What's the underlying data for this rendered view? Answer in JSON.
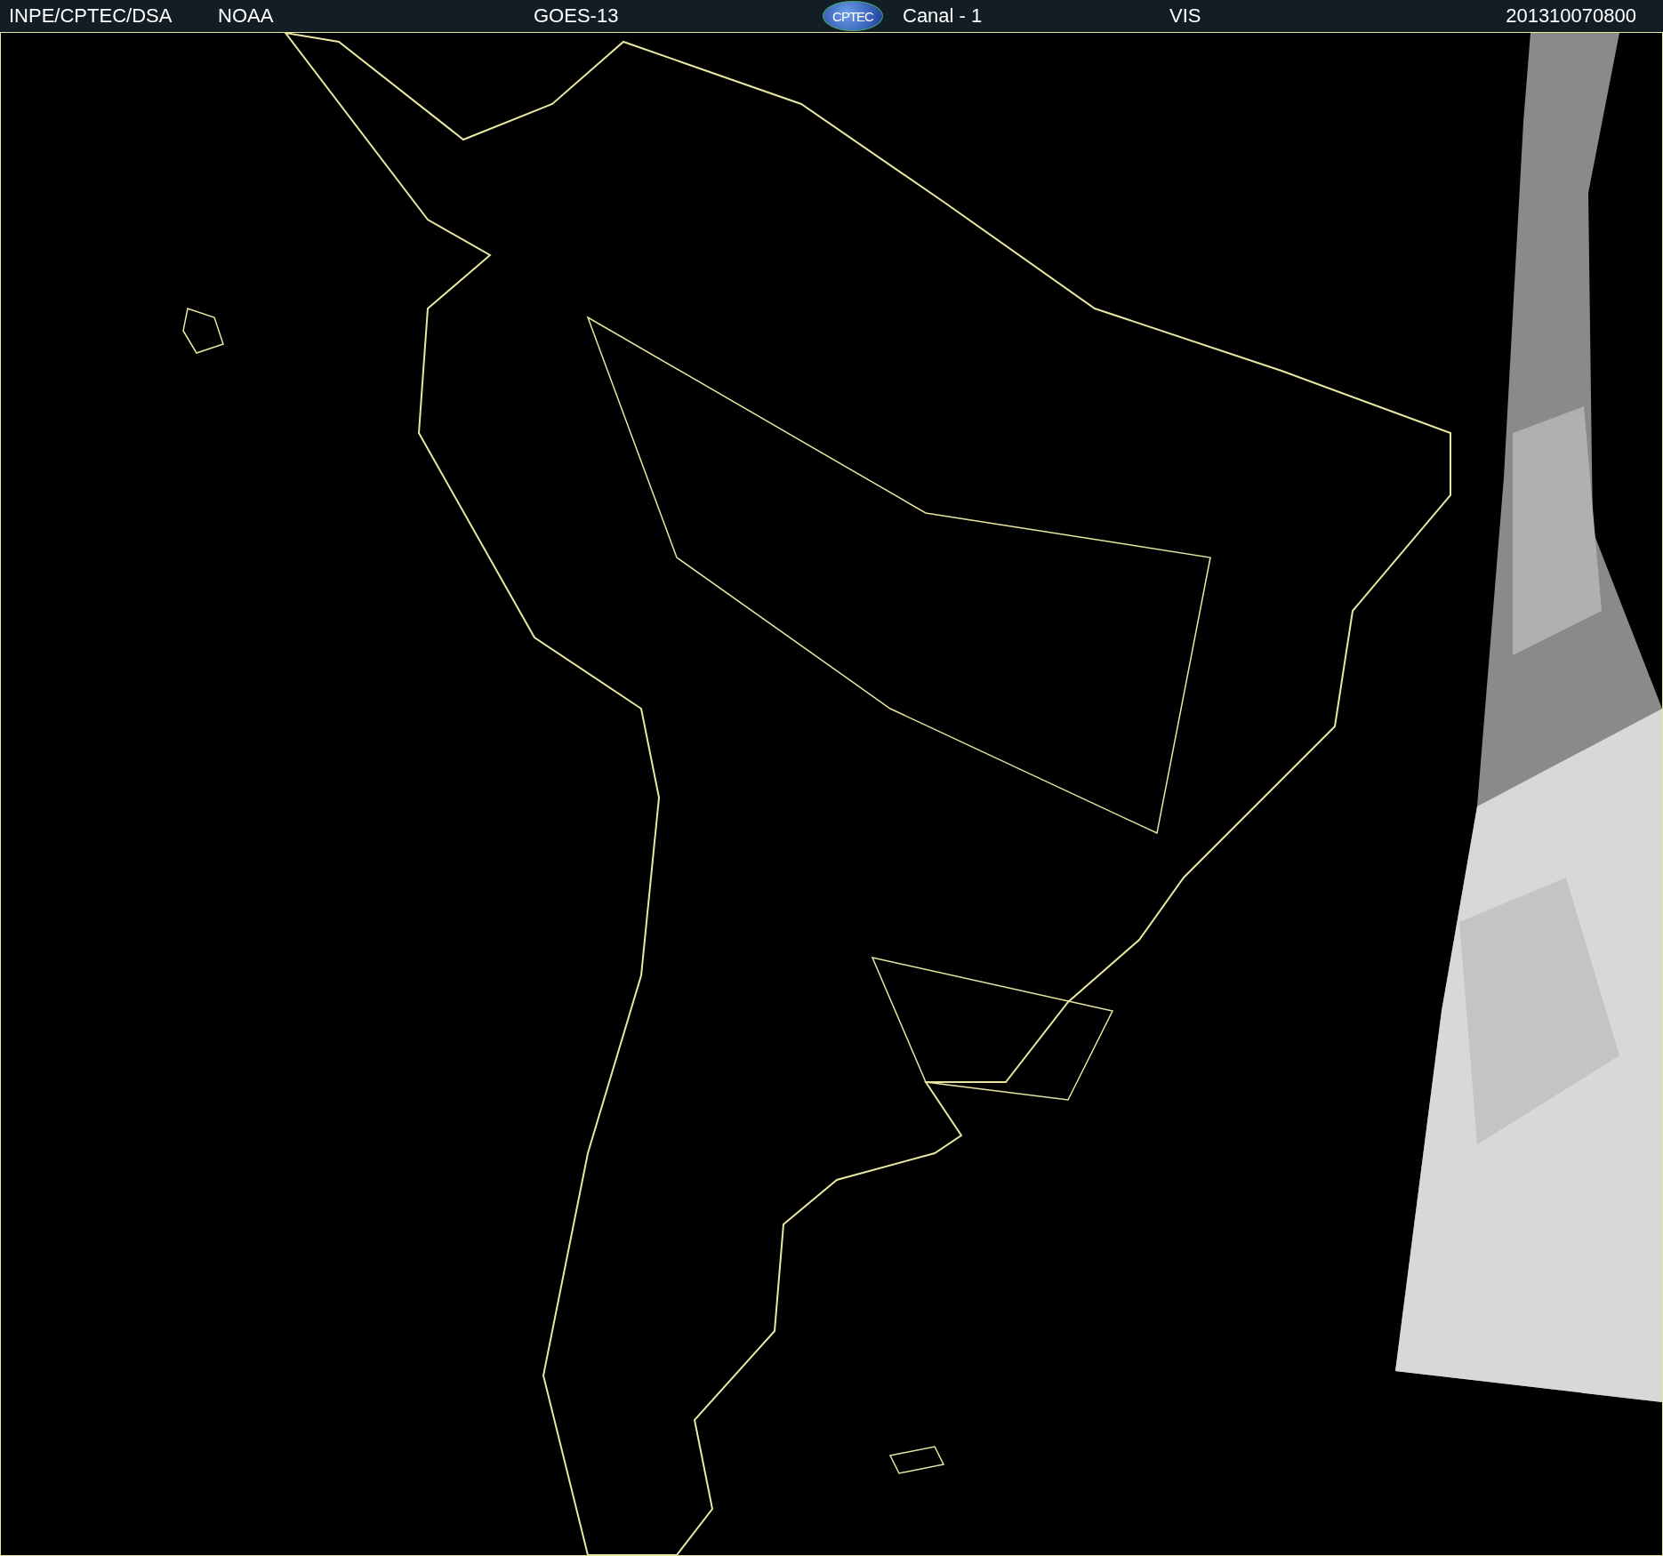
{
  "header": {
    "source": "INPE/CPTEC/DSA",
    "agency": "NOAA",
    "satellite": "GOES-13",
    "logo": "CPTEC",
    "channel": "Canal - 1",
    "band": "VIS",
    "timestamp": "201310070800"
  }
}
